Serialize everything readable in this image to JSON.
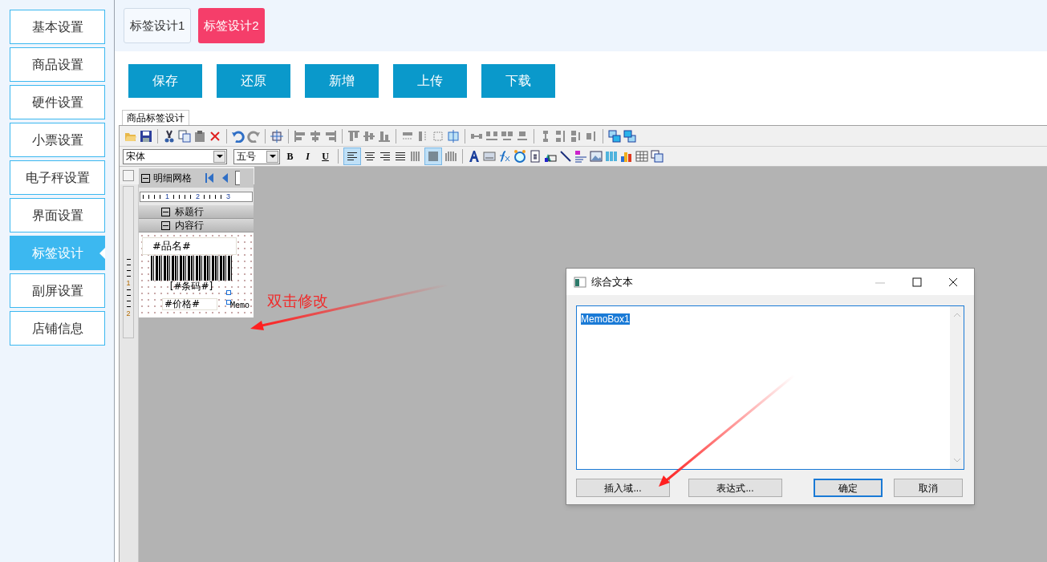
{
  "sidebar": {
    "items": [
      {
        "label": "基本设置",
        "selected": false
      },
      {
        "label": "商品设置",
        "selected": false
      },
      {
        "label": "硬件设置",
        "selected": false
      },
      {
        "label": "小票设置",
        "selected": false
      },
      {
        "label": "电子秤设置",
        "selected": false
      },
      {
        "label": "界面设置",
        "selected": false
      },
      {
        "label": "标签设计",
        "selected": true
      },
      {
        "label": "副屏设置",
        "selected": false
      },
      {
        "label": "店铺信息",
        "selected": false
      }
    ]
  },
  "tabs": [
    {
      "label": "标签设计1",
      "selected": false
    },
    {
      "label": "标签设计2",
      "selected": true
    }
  ],
  "actions": [
    "保存",
    "还原",
    "新增",
    "上传",
    "下载"
  ],
  "designer": {
    "tab": "商品标签设计",
    "font": "宋体",
    "size": "五号",
    "format_buttons": [
      "B",
      "I",
      "U"
    ],
    "ruler_labels": [
      "1",
      "2",
      "3"
    ],
    "band_title": "明细网格",
    "bands": [
      {
        "label": "标题行",
        "expanded": true
      },
      {
        "label": "内容行",
        "expanded": true
      }
    ],
    "side_ruler": [
      "1",
      "2"
    ],
    "fields": [
      "#品名#",
      "[#条码#]",
      "#价格#"
    ],
    "memo": "Memo"
  },
  "annotation": "双击修改",
  "dialog": {
    "title": "综合文本",
    "memo_text": "MemoBox1",
    "buttons": [
      {
        "label": "插入域...",
        "default": false
      },
      {
        "label": "表达式...",
        "default": false
      },
      {
        "label": "确定",
        "default": true
      },
      {
        "label": "取消",
        "default": false
      }
    ]
  }
}
